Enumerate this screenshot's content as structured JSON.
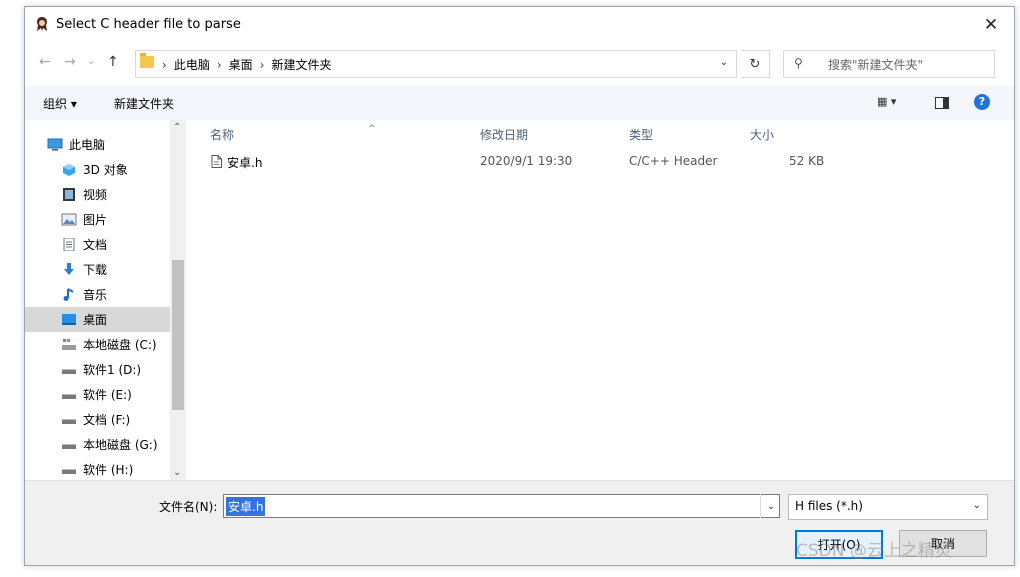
{
  "window": {
    "title": "Select C header file to parse",
    "close_label": "✕"
  },
  "nav": {
    "back": "←",
    "forward": "→",
    "history": "⌄",
    "up": "↑"
  },
  "address": {
    "breadcrumb": [
      "此电脑",
      "桌面",
      "新建文件夹"
    ],
    "separator": "›",
    "dropdown": "⌄",
    "refresh": "↻"
  },
  "search": {
    "placeholder": "搜索\"新建文件夹\"",
    "icon_glyph": "⚲"
  },
  "toolbar": {
    "organize": "组织 ▾",
    "new_folder": "新建文件夹",
    "views": "▦ ▾",
    "help": "?"
  },
  "sidebar": {
    "items": [
      {
        "label": "此电脑",
        "icon": "pc-icon"
      },
      {
        "label": "3D 对象",
        "icon": "3d-objects-icon"
      },
      {
        "label": "视频",
        "icon": "video-icon"
      },
      {
        "label": "图片",
        "icon": "pictures-icon"
      },
      {
        "label": "文档",
        "icon": "documents-icon"
      },
      {
        "label": "下载",
        "icon": "download-icon"
      },
      {
        "label": "音乐",
        "icon": "music-icon"
      },
      {
        "label": "桌面",
        "icon": "desktop-icon",
        "selected": true
      },
      {
        "label": "本地磁盘 (C:)",
        "icon": "system-drive-icon"
      },
      {
        "label": "软件1 (D:)",
        "icon": "drive-icon"
      },
      {
        "label": "软件 (E:)",
        "icon": "drive-icon"
      },
      {
        "label": "文档 (F:)",
        "icon": "drive-icon"
      },
      {
        "label": "本地磁盘 (G:)",
        "icon": "drive-icon"
      },
      {
        "label": "软件 (H:)",
        "icon": "drive-icon"
      }
    ],
    "scroll_up": "⌃",
    "scroll_down": "⌄"
  },
  "columns": {
    "name": "名称",
    "date": "修改日期",
    "type": "类型",
    "size": "大小",
    "sort_caret": "^"
  },
  "files": [
    {
      "name": "安卓.h",
      "date": "2020/9/1 19:30",
      "type": "C/C++ Header",
      "size": "52 KB"
    }
  ],
  "bottom": {
    "filename_label": "文件名(N):",
    "filename_value": "安卓.h",
    "filename_dropdown": "⌄",
    "filetype_value": "H files (*.h)",
    "filetype_dropdown": "⌄",
    "open_label": "打开(O)",
    "cancel_label": "取消"
  },
  "watermark": "CSDN @云上之精灵",
  "colors": {
    "accent": "#0078d7",
    "selection": "#3373e0",
    "toolbar_bg": "#f3f6fa",
    "footer_bg": "#f0f0f0"
  }
}
